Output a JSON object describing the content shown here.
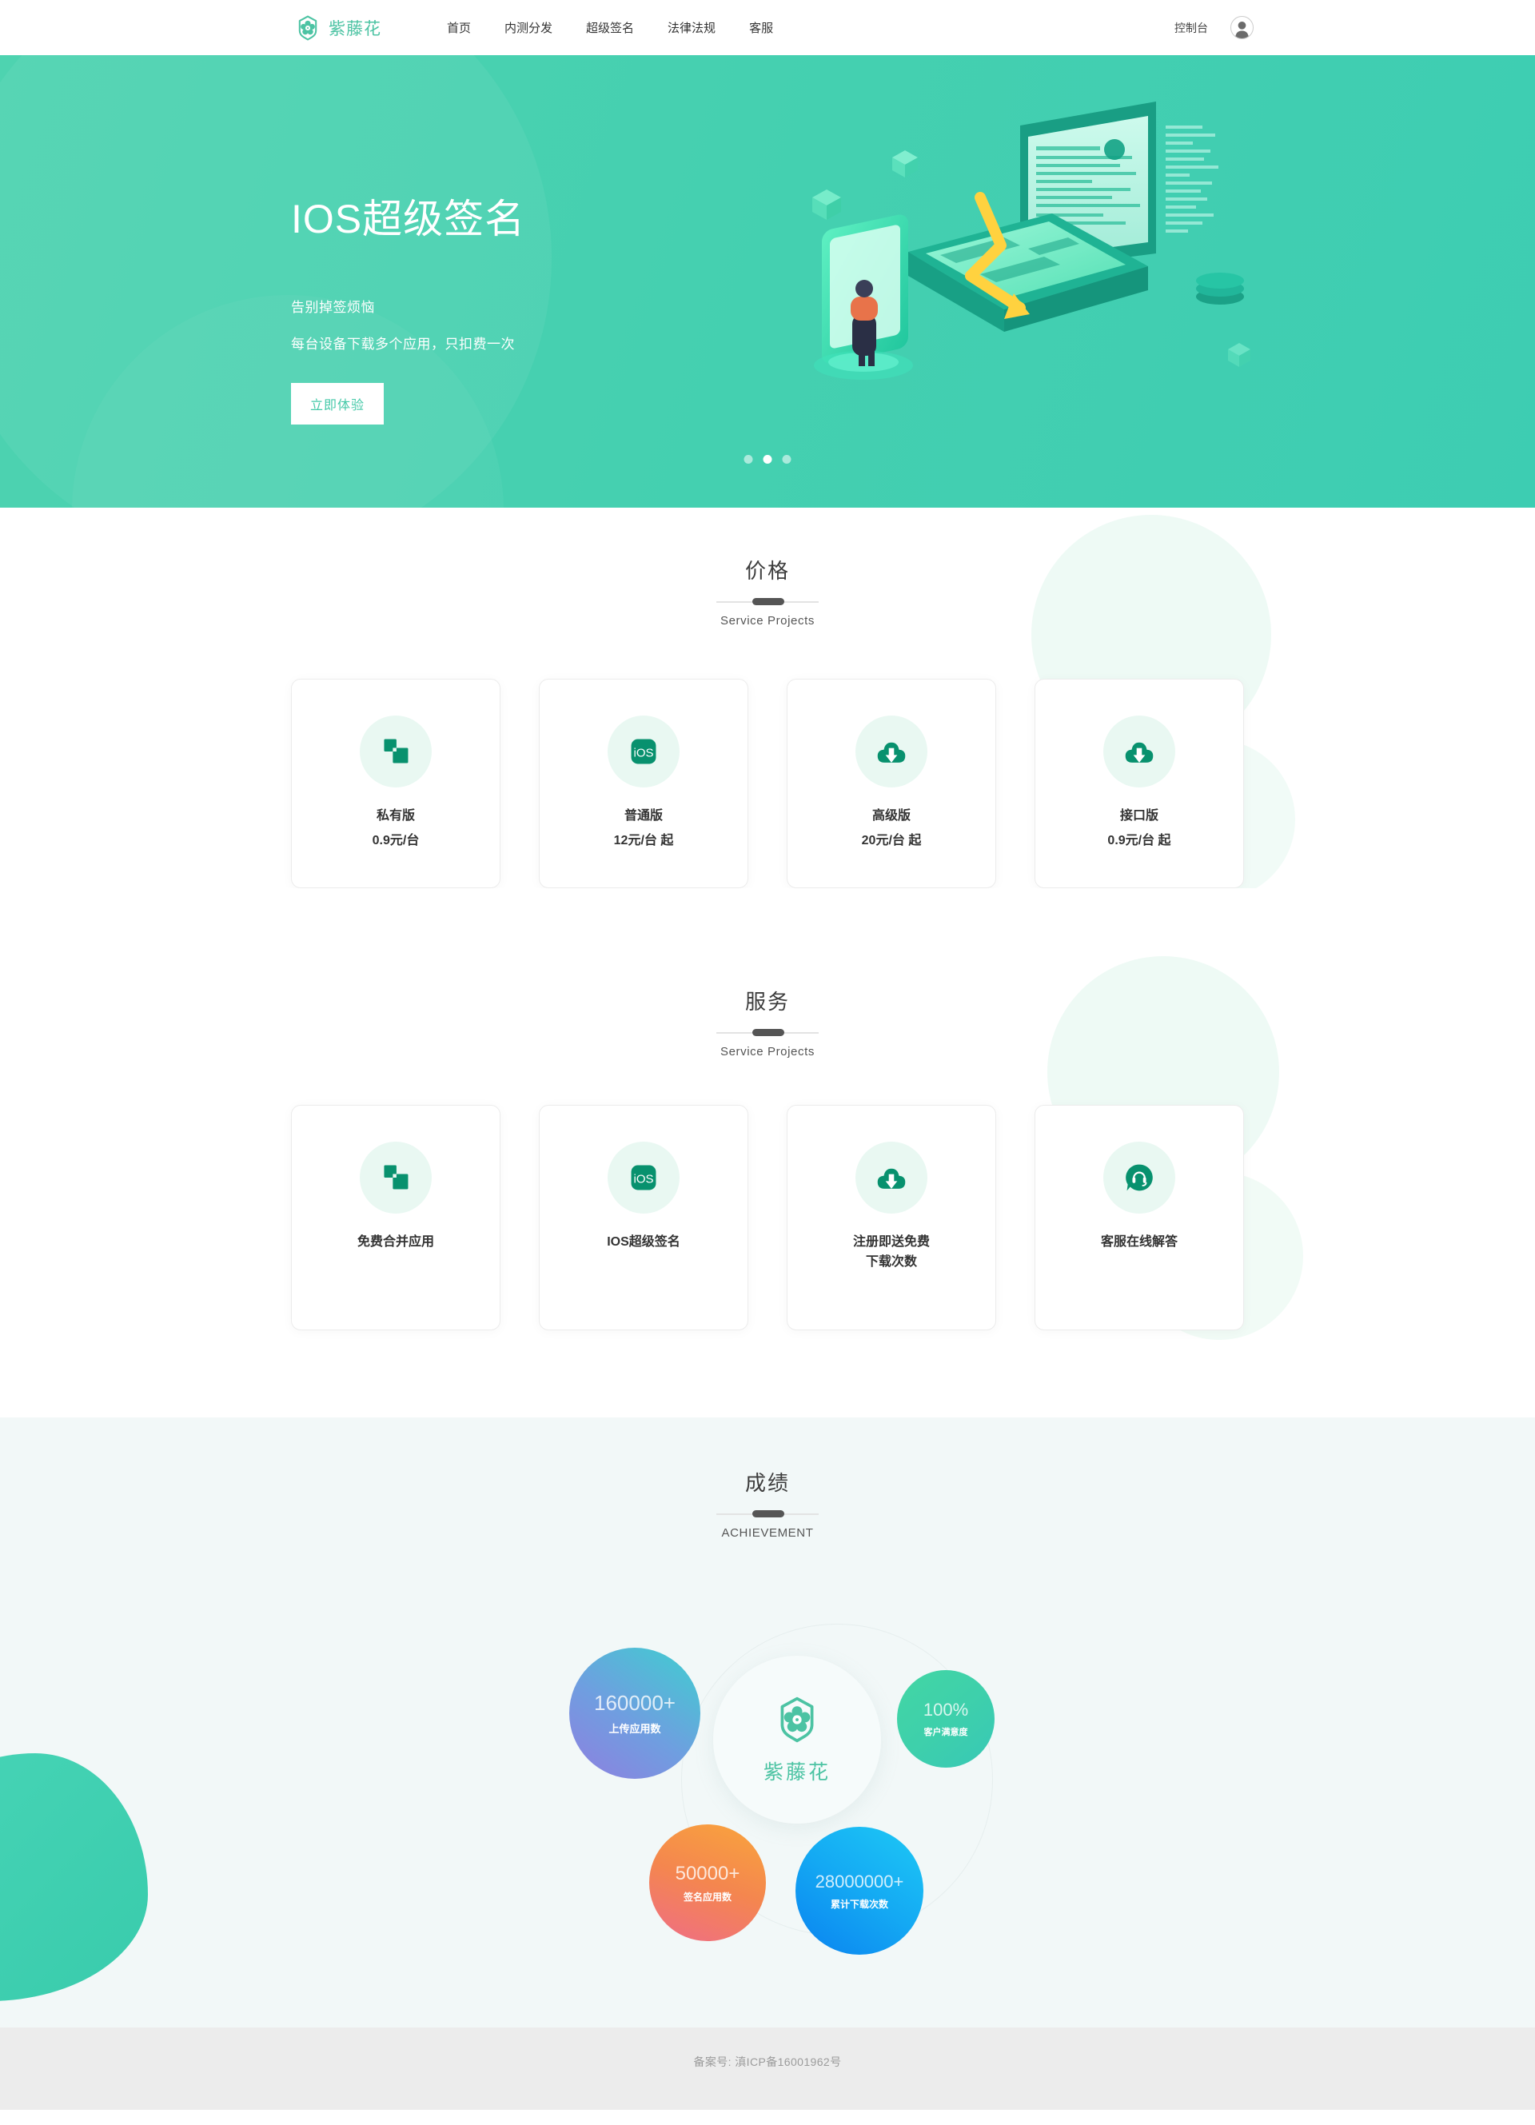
{
  "header": {
    "brand": "紫藤花",
    "logo_icon": "flower-logo-icon",
    "nav": [
      {
        "label": "首页",
        "name": "nav-item-home",
        "active": true
      },
      {
        "label": "内测分发",
        "name": "nav-item-beta-distribution",
        "active": false
      },
      {
        "label": "超级签名",
        "name": "nav-item-super-signature",
        "active": false
      },
      {
        "label": "法律法规",
        "name": "nav-item-legal",
        "active": false
      },
      {
        "label": "客服",
        "name": "nav-item-support",
        "active": false
      }
    ],
    "console_label": "控制台",
    "avatar_icon": "user-avatar-icon"
  },
  "hero": {
    "title": "IOS超级签名",
    "sub1": "告别掉签烦恼",
    "sub2": "每台设备下载多个应用，只扣费一次",
    "cta": "立即体验",
    "accent": "#45d0b0",
    "carousel": {
      "count": 3,
      "active_index": 1
    }
  },
  "pricing": {
    "title": "价格",
    "subtitle": "Service Projects",
    "cards": [
      {
        "icon": "merge-squares-icon",
        "name": "私有版",
        "price": "0.9元/台"
      },
      {
        "icon": "ios-app-icon",
        "name": "普通版",
        "price": "12元/台 起"
      },
      {
        "icon": "cloud-download-icon",
        "name": "高级版",
        "price": "20元/台 起"
      },
      {
        "icon": "cloud-download-icon",
        "name": "接口版",
        "price": "0.9元/台 起"
      }
    ]
  },
  "services": {
    "title": "服务",
    "subtitle": "Service Projects",
    "cards": [
      {
        "icon": "merge-squares-icon",
        "label": "免费合并应用"
      },
      {
        "icon": "ios-app-icon",
        "label": "IOS超级签名"
      },
      {
        "icon": "cloud-download-icon",
        "label": "注册即送免费\n下载次数"
      },
      {
        "icon": "headset-support-icon",
        "label": "客服在线解答"
      }
    ]
  },
  "achievement": {
    "title": "成绩",
    "subtitle": "ACHIEVEMENT",
    "center_brand": "紫藤花",
    "center_icon": "flower-logo-icon",
    "bubbles": [
      {
        "value": "160000+",
        "label": "上传应用数",
        "color_from": "#8f7fe0",
        "color_to": "#3ecfd0",
        "name": "stat-uploaded-apps"
      },
      {
        "value": "100%",
        "label": "客户满意度",
        "color_from": "#3fd2a8",
        "color_to": "#3ec8b4",
        "name": "stat-satisfaction"
      },
      {
        "value": "50000+",
        "label": "签名应用数",
        "color_from": "#f9a53c",
        "color_to": "#ef6d86",
        "name": "stat-signed-apps"
      },
      {
        "value": "28000000+",
        "label": "累计下载次数",
        "color_from": "#1ec9f5",
        "color_to": "#0a82f0",
        "name": "stat-total-downloads"
      }
    ]
  },
  "footer": {
    "icp": "备案号: 滇ICP备16001962号"
  }
}
